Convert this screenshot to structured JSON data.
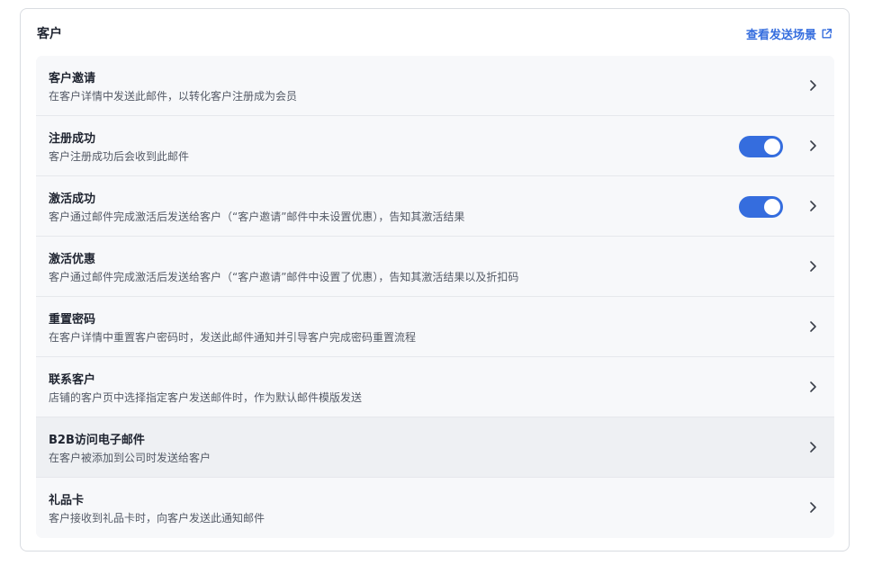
{
  "section": {
    "title": "客户",
    "link_label": "查看发送场景",
    "link_icon": "external-link-icon",
    "accent_color": "#356dde"
  },
  "items": [
    {
      "title": "客户邀请",
      "description": "在客户详情中发送此邮件，以转化客户注册成为会员",
      "has_toggle": false
    },
    {
      "title": "注册成功",
      "description": "客户注册成功后会收到此邮件",
      "has_toggle": true,
      "toggle_on": true
    },
    {
      "title": "激活成功",
      "description": "客户通过邮件完成激活后发送给客户（“客户邀请”邮件中未设置优惠），告知其激活结果",
      "has_toggle": true,
      "toggle_on": true
    },
    {
      "title": "激活优惠",
      "description": "客户通过邮件完成激活后发送给客户（“客户邀请”邮件中设置了优惠），告知其激活结果以及折扣码",
      "has_toggle": false
    },
    {
      "title": "重置密码",
      "description": "在客户详情中重置客户密码时，发送此邮件通知并引导客户完成密码重置流程",
      "has_toggle": false
    },
    {
      "title": "联系客户",
      "description": "店铺的客户页中选择指定客户发送邮件时，作为默认邮件模版发送",
      "has_toggle": false
    },
    {
      "title": "B2B访问电子邮件",
      "description": "在客户被添加到公司时发送给客户",
      "has_toggle": false,
      "hovered": true
    },
    {
      "title": "礼品卡",
      "description": "客户接收到礼品卡时，向客户发送此通知邮件",
      "has_toggle": false
    }
  ]
}
